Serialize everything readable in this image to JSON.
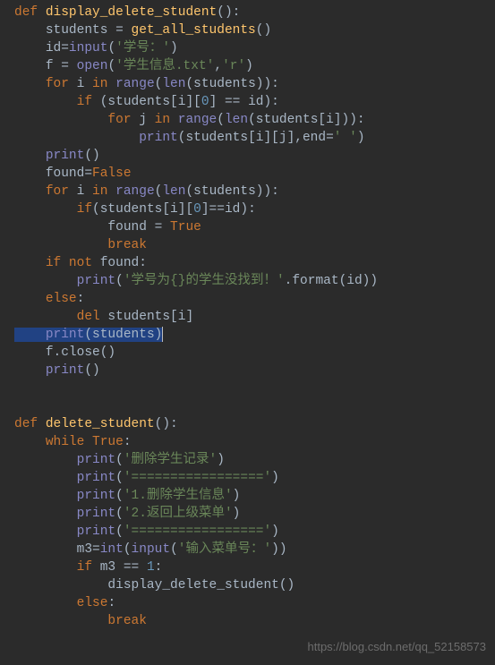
{
  "func1": {
    "def": "def",
    "name": "display_delete_student",
    "line2_students": "students = ",
    "line2_call": "get_all_students",
    "line3_id": "id",
    "line3_input": "input",
    "line3_str": "'学号：'",
    "line4_f": "f = ",
    "line4_open": "open",
    "line4_str": "'学生信息.txt'",
    "line4_mode": "'r'",
    "for": "for",
    "in": "in",
    "range": "range",
    "len": "len",
    "line5_var": " i ",
    "line5_arg": "(students)):",
    "if": "if",
    "line6_cond": " (students[i][",
    "line6_zero": "0",
    "line6_rest": "] == id):",
    "line7_j": " j ",
    "line7_rest": "(students[i])):",
    "print": "print",
    "line8_arg": "(students[i][j],end=",
    "line8_str": "' '",
    "line10_found": "found=",
    "false": "False",
    "line11_i": " i ",
    "line11_rest": "(students)):",
    "line12_cond": "(students[i][",
    "line12_zero": "0",
    "line12_rest": "]==id):",
    "line13_found": "found = ",
    "true": "True",
    "break": "break",
    "not": "not",
    "line15_found": " found:",
    "line16_str": "'学号为{}的学生没找到！'",
    "line16_fmt": ".format(id))",
    "else": "else",
    "del": "del",
    "line18_students": " students[i]",
    "line19_arg": "(students)",
    "line20_close": "f.close()"
  },
  "func2": {
    "def": "def",
    "name": "delete_student",
    "while": "while",
    "true": "True",
    "print": "print",
    "str1": "'删除学生记录'",
    "str2": "'================='",
    "str3": "'1.删除学生信息'",
    "str4": "'2.返回上级菜单'",
    "str5": "'================='",
    "m3": "m3=",
    "int": "int",
    "input": "input",
    "str6": "'输入菜单号：'",
    "if": "if",
    "cond": " m3 == ",
    "one": "1",
    "call": "display_delete_student()",
    "else": "else",
    "break": "break"
  },
  "watermark": "https://blog.csdn.net/qq_52158573"
}
